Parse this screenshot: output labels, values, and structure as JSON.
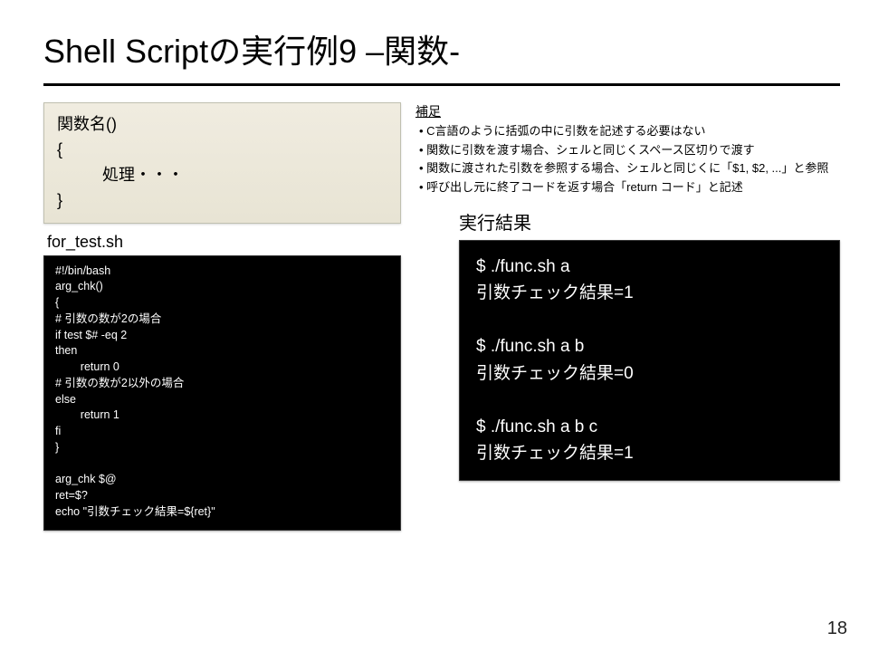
{
  "title": "Shell Scriptの実行例9 –関数-",
  "syntax": "関数名()\n{\n          処理・・・\n}",
  "file_label": "for_test.sh",
  "code": "#!/bin/bash\narg_chk()\n{\n# 引数の数が2の場合\nif test $# -eq 2\nthen\n        return 0\n# 引数の数が2以外の場合\nelse\n        return 1\nfi\n}\n\narg_chk $@\nret=$?\necho \"引数チェック結果=${ret}\"",
  "notes": {
    "heading": "補足",
    "items": [
      "C言語のように括弧の中に引数を記述する必要はない",
      "関数に引数を渡す場合、シェルと同じくスペース区切りで渡す",
      "関数に渡された引数を参照する場合、シェルと同じくに「$1, $2, ...」と参照",
      "呼び出し元に終了コードを返す場合「return コード」と記述"
    ]
  },
  "result_label": "実行結果",
  "result": "$ ./func.sh a\n引数チェック結果=1\n\n$ ./func.sh a b\n引数チェック結果=0\n\n$ ./func.sh a b c\n引数チェック結果=1",
  "page_number": "18"
}
